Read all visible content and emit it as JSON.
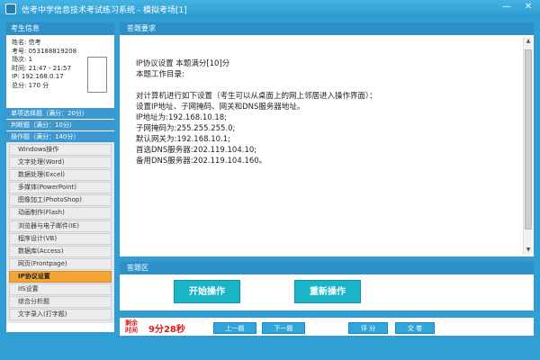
{
  "window": {
    "title": "信考中学信息技术考试练习系统 - 模拟考场[1]",
    "minimize": "—",
    "close": "✕"
  },
  "sidebar": {
    "info_header": "考生信息",
    "info": {
      "name": "姓名: 信考",
      "exam_no": "考号: 053188819208",
      "room": "场次: 1",
      "time": "时间: 21:47 - 21:57",
      "ip": "IP:   192.168.0.17",
      "score": "总分: 170 分"
    },
    "sections": [
      {
        "label": "单项选择题（满分：20分）"
      },
      {
        "label": "判断题（满分：10分）"
      },
      {
        "label": "操作题（满分：140分）"
      }
    ],
    "items": [
      {
        "label": "Windows操作"
      },
      {
        "label": "文字处理(Word)"
      },
      {
        "label": "数据处理(Excel)"
      },
      {
        "label": "多媒体(PowerPoint)"
      },
      {
        "label": "图像加工(PhotoShop)"
      },
      {
        "label": "动画制作(Flash)"
      },
      {
        "label": "浏览器与电子邮件(IE)"
      },
      {
        "label": "程序设计(VB)"
      },
      {
        "label": "数据库(Access)"
      },
      {
        "label": "网页(Frontpage)"
      },
      {
        "label": "IP协议设置"
      },
      {
        "label": "IIS设置"
      },
      {
        "label": "综合分析题"
      },
      {
        "label": "文字录入(打字题)"
      }
    ]
  },
  "question": {
    "header": "答题要求",
    "lines": [
      "IP协议设置  本题满分[10]分",
      "本题工作目录:",
      "",
      "对计算机进行如下设置（考生可以从桌面上的网上邻居进入操作界面）：",
      "设置IP地址、子网掩码、网关和DNS服务器地址。",
      "IP地址为:192.168.10.18;",
      "子网掩码为:255.255.255.0;",
      "默认网关为:192.168.10.1;",
      "首选DNS服务器:202.119.104.10;",
      "备用DNS服务器:202.119.104.160。"
    ]
  },
  "answer": {
    "header": "答题区",
    "start_label": "开始操作",
    "redo_label": "重新操作"
  },
  "footer": {
    "remain_label": "剩余时间",
    "remain_time": "9分28秒",
    "prev_label": "上一题",
    "next_label": "下一题",
    "grade_label": "评 分",
    "submit_label": "交 卷"
  },
  "colors": {
    "accent": "#2c91cb",
    "active_item": "#f4a534",
    "action_button": "#1ab4c8",
    "timer": "#d61f1f"
  }
}
